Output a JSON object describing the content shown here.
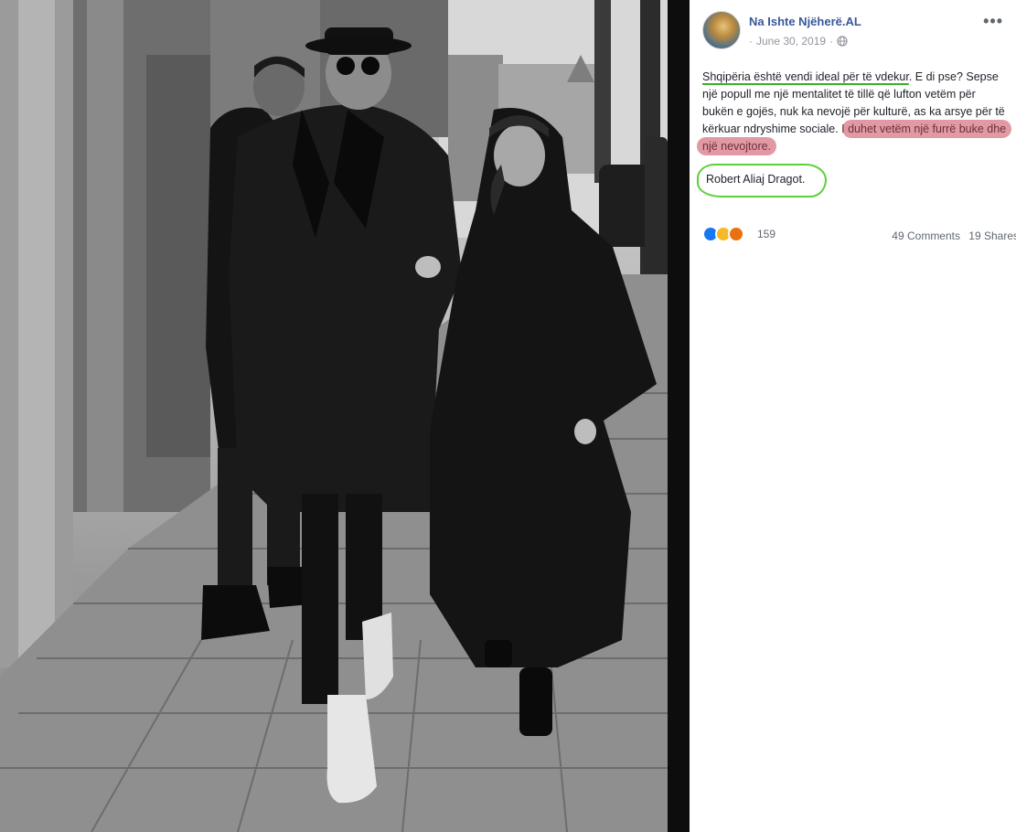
{
  "post": {
    "page_name": "Na Ishte Njëherë.AL",
    "date": "June 30, 2019",
    "date_separator": "·",
    "more_label": "•••",
    "text": {
      "underlined": "Shqipëria është vendi ideal për të vdekur",
      "line1_rest": ". E di pse? Sepse një popull me një mentalitet të tillë që lufton vetëm për bukën e gojës, nuk ka nevojë për kulturë, as ka arsye për të kërkuar ndryshime sociale. I",
      "highlighted": "duhet vetëm një furrë buke dhe një nevojtore.",
      "signature": "Robert Aliaj Dragot."
    }
  },
  "engagement": {
    "reaction_count": "159",
    "comments": "49 Comments",
    "shares": "19 Shares",
    "reaction_icons": [
      "like-icon",
      "haha-icon",
      "angry-icon"
    ]
  },
  "colors": {
    "link_blue": "#385898",
    "underline_green": "#3fae2a",
    "highlight_red": "#c8465a"
  }
}
